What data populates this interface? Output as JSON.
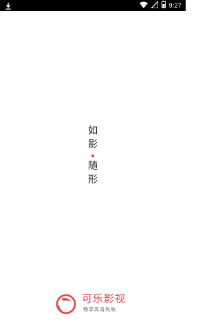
{
  "status_bar": {
    "time": "9:27",
    "icons": [
      "download-icon",
      "wifi-icon",
      "signal-icon",
      "battery-icon"
    ]
  },
  "splash": {
    "slogan": [
      "如",
      "影",
      "随",
      "形"
    ]
  },
  "brand": {
    "name": "可乐影视",
    "tagline": "畅享高清热映"
  },
  "colors": {
    "accent": "#e8474d",
    "status_bar_bg": "#000000",
    "background": "#ffffff"
  }
}
